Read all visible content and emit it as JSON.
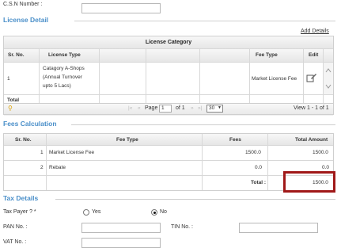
{
  "csn": {
    "label": "C.S.N Number :",
    "value": ""
  },
  "license": {
    "section_title": "License Detail",
    "add_details": "Add Details",
    "group_header": "License Category",
    "columns": {
      "sr": "Sr. No.",
      "type": "License Type",
      "fee_type": "Fee Type",
      "edit": "Edit"
    },
    "row": {
      "sr": "1",
      "type_lines": [
        "Catagory A-Shops",
        "(Annual Turnover",
        "upto 5 Lacs)"
      ],
      "fee_type": "Market License Fee"
    },
    "total_label": "Total",
    "pager": {
      "page_label": "Page",
      "page_value": "1",
      "of_label": "of 1",
      "rows": "30",
      "view": "View 1 - 1 of 1"
    }
  },
  "fees": {
    "section_title": "Fees Calculation",
    "columns": {
      "sr": "Sr. No.",
      "fee_type": "Fee Type",
      "fees": "Fees",
      "total": "Total Amount"
    },
    "rows": [
      {
        "sr": "1",
        "fee_type": "Market License Fee",
        "fees": "1500.0",
        "total": "1500.0"
      },
      {
        "sr": "2",
        "fee_type": "Rebate",
        "fees": "0.0",
        "total": "0.0"
      }
    ],
    "total_label": "Total :",
    "total_value": "1500.0",
    "highlight_color": "#a01818"
  },
  "tax": {
    "section_title": "Tax Details",
    "tax_payer_label": "Tax Payer ? *",
    "yes": "Yes",
    "no": "No",
    "selected": "No",
    "pan_label": "PAN No. :",
    "tin_label": "TIN No. :",
    "vat_label": "VAT No. :"
  }
}
